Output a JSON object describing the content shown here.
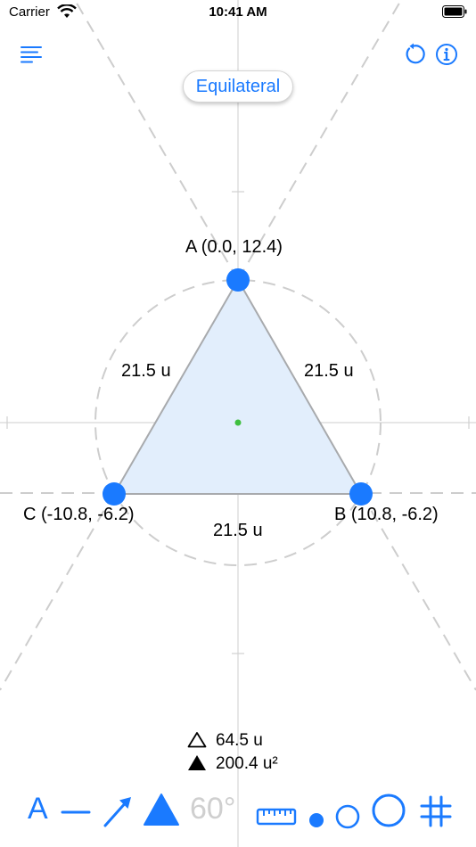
{
  "status_bar": {
    "carrier": "Carrier",
    "time": "10:41 AM"
  },
  "header": {
    "mode_label": "Equilateral",
    "menu_icon": "list-menu-icon",
    "reset_icon": "rotate-reset-icon",
    "info_icon": "info-circle-icon"
  },
  "triangle": {
    "vertex_a": "A (0.0, 12.4)",
    "vertex_b": "B (10.8, -6.2)",
    "vertex_c": "C (-10.8, -6.2)",
    "side_ab": "21.5 u",
    "side_ac": "21.5 u",
    "side_bc": "21.5 u"
  },
  "stats": {
    "perimeter": "64.5 u",
    "area": "200.4 u²"
  },
  "toolbar": {
    "label_tool": "A",
    "angle_tool": "60°"
  },
  "colors": {
    "accent": "#1a7aff",
    "triangle_fill": "#e2eefc",
    "triangle_stroke": "#a8aaad",
    "guide_lines": "#cfcfcf",
    "center_point": "#3fbf3f",
    "disabled": "#cfcfcf"
  }
}
